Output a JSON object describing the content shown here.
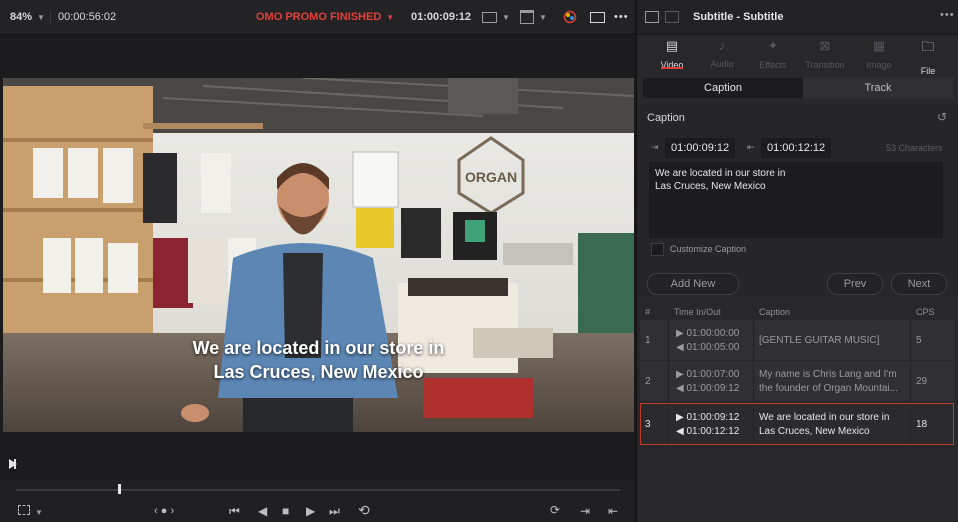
{
  "viewer": {
    "zoom": "84%",
    "timecode_left": "00:00:56:02",
    "timeline_name": "OMO PROMO FINISHED",
    "timecode_right": "01:00:09:12",
    "subtitle_line1": "We are located in our store in",
    "subtitle_line2": "Las Cruces, New Mexico"
  },
  "inspector": {
    "title": "Subtitle - Subtitle",
    "tabs": [
      "Video",
      "Audio",
      "Effects",
      "Transition",
      "Image",
      "File"
    ],
    "active_tab": "Video",
    "segments": [
      "Caption",
      "Track"
    ],
    "section_title": "Caption",
    "in_tc": "01:00:09:12",
    "out_tc": "01:00:12:12",
    "char_count": "53 Characters",
    "caption_text_line1": "We are located in our store in",
    "caption_text_line2": "Las Cruces, New Mexico",
    "customize_label": "Customize Caption",
    "add_new": "Add New",
    "prev": "Prev",
    "next": "Next"
  },
  "caption_table": {
    "headers": [
      "#",
      "Time In/Out",
      "Caption",
      "CPS"
    ],
    "rows": [
      {
        "num": "1",
        "in": "01:00:00:00",
        "out": "01:00:05:00",
        "caption1": "[GENTLE GUITAR MUSIC]",
        "caption2": "",
        "cps": "5"
      },
      {
        "num": "2",
        "in": "01:00:07:00",
        "out": "01:00:09:12",
        "caption1": "My name is Chris Lang and I'm",
        "caption2": "the founder of Organ Mountai...",
        "cps": "29"
      },
      {
        "num": "3",
        "in": "01:00:09:12",
        "out": "01:00:12:12",
        "caption1": "We are located in our store in",
        "caption2": "Las Cruces, New Mexico",
        "cps": "18"
      }
    ],
    "selected_row": 3
  },
  "colors": {
    "accent_red": "#e0413a",
    "timeline_name": "#e0413a",
    "selection_border": "#c0392b"
  }
}
